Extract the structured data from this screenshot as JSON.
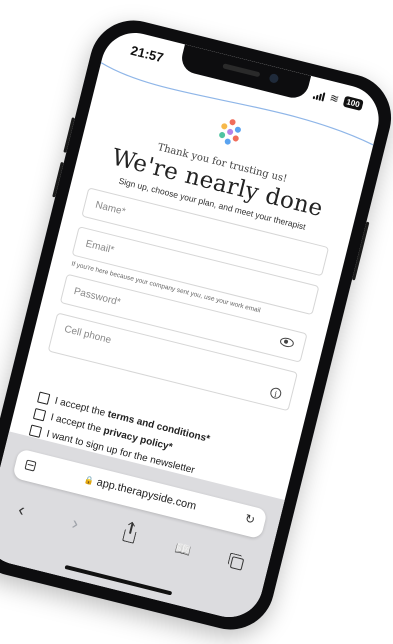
{
  "status": {
    "time": "21:57",
    "battery": "100"
  },
  "page": {
    "thanks": "Thank you for trusting us!",
    "title": "We're nearly done",
    "subtitle": "Sign up, choose your plan, and meet your therapist"
  },
  "form": {
    "name_placeholder": "Name*",
    "email_placeholder": "Email*",
    "email_helper": "If you're here because your company sent you, use your work email",
    "password_placeholder": "Password*",
    "phone_placeholder": "Cell phone",
    "info_glyph": "i"
  },
  "checks": {
    "terms_prefix": "I accept the ",
    "terms_bold": "terms and conditions*",
    "privacy_prefix": "I accept the ",
    "privacy_bold": "privacy policy*",
    "newsletter": "I want to sign up for the newsletter"
  },
  "browser": {
    "url": "app.therapyside.com",
    "back_glyph": "‹",
    "forward_glyph": "›",
    "reload_glyph": "↻",
    "book_glyph": "📖"
  },
  "icons": {
    "logo": "therapyside-logo",
    "eye": "eye-icon",
    "info": "info-icon",
    "share": "share-icon",
    "tabs": "tabs-icon",
    "bookmarks": "bookmarks-icon"
  },
  "colors": {
    "wave": "#8fb6e8",
    "logo_dots": [
      "#f06d5b",
      "#f7b84a",
      "#4fc3a1",
      "#5aa3f0",
      "#b583e8"
    ]
  }
}
